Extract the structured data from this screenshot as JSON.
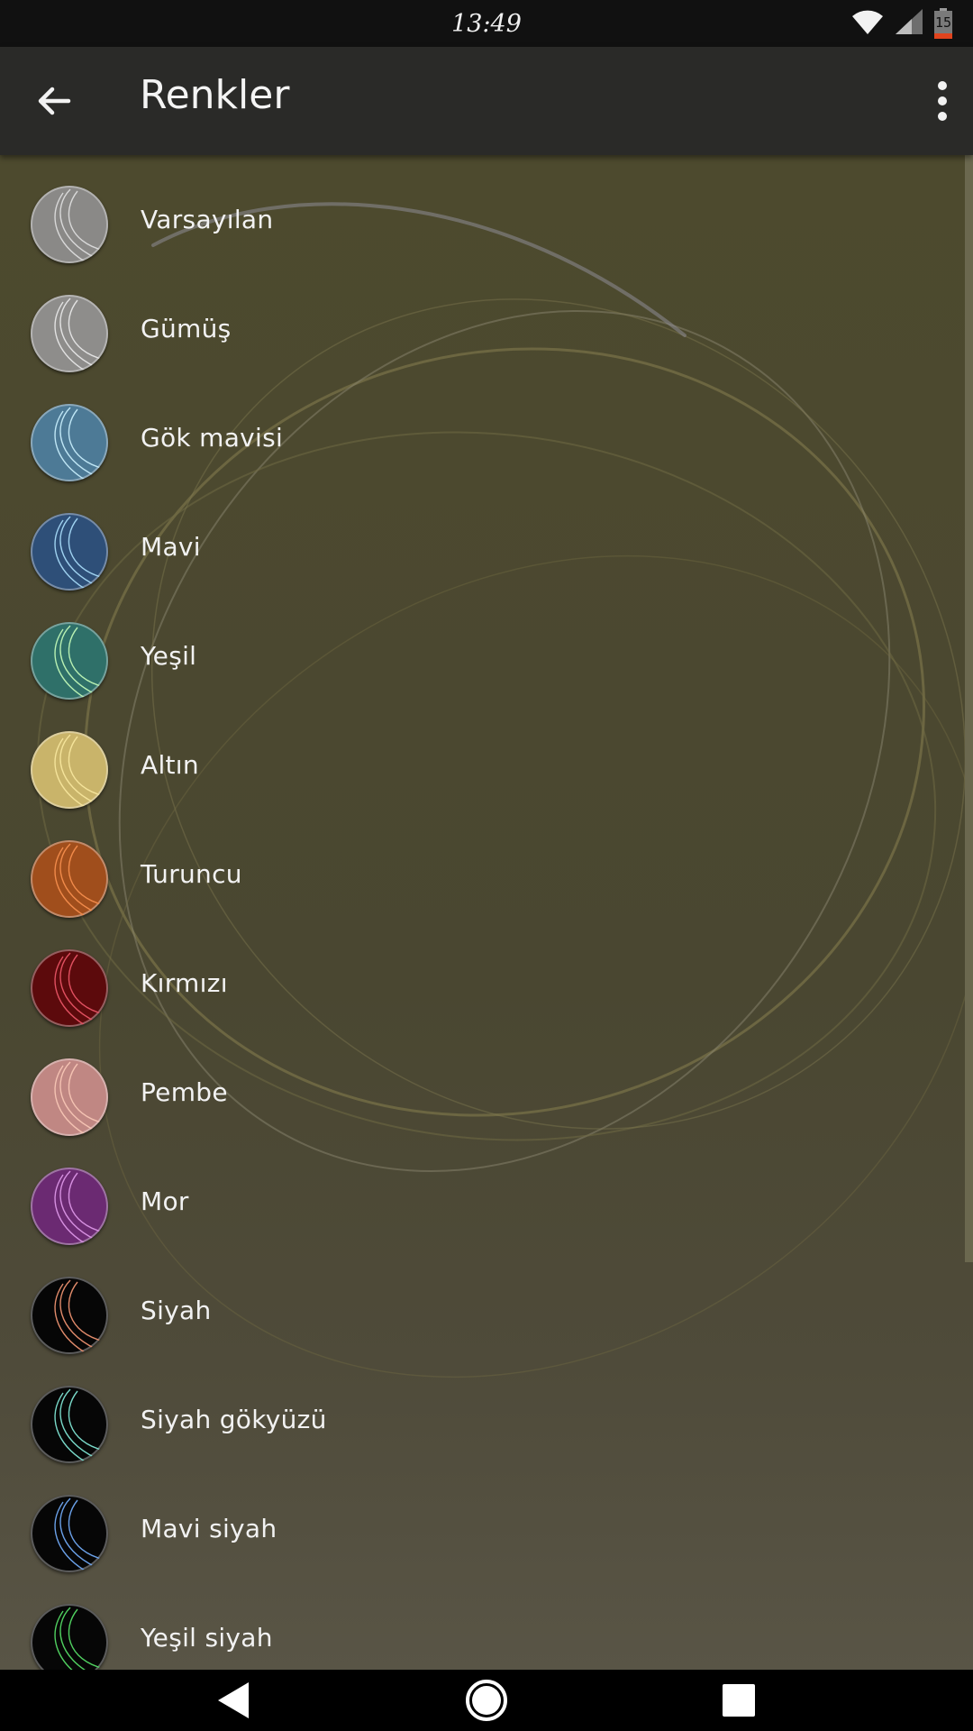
{
  "status_bar": {
    "time": "13:49",
    "battery_level": "15",
    "icons": [
      "wifi-icon",
      "cell-signal-icon",
      "battery-icon"
    ]
  },
  "app_bar": {
    "title": "Renkler",
    "back_icon": "arrow-back-icon",
    "menu_icon": "more-vertical-icon"
  },
  "colors": [
    {
      "label": "Varsayılan",
      "swatch": "#8a8987",
      "line": "#d8d8d8"
    },
    {
      "label": "Gümüş",
      "swatch": "#8e8d8b",
      "line": "#e2e2e2"
    },
    {
      "label": "Gök mavisi",
      "swatch": "#4d7a96",
      "line": "#bfe6f5"
    },
    {
      "label": "Mavi",
      "swatch": "#2e4f78",
      "line": "#9fd2f0"
    },
    {
      "label": "Yeşil",
      "swatch": "#2f7069",
      "line": "#b8f0b2"
    },
    {
      "label": "Altın",
      "swatch": "#c9b46a",
      "line": "#f4e39a"
    },
    {
      "label": "Turuncu",
      "swatch": "#a04e1c",
      "line": "#f08a4a"
    },
    {
      "label": "Kırmızı",
      "swatch": "#5c0a0c",
      "line": "#e05060"
    },
    {
      "label": "Pembe",
      "swatch": "#c08783",
      "line": "#f4c2b2"
    },
    {
      "label": "Mor",
      "swatch": "#6b2a72",
      "line": "#d690e0"
    },
    {
      "label": "Siyah",
      "swatch": "#060606",
      "line": "#e08a6a"
    },
    {
      "label": "Siyah gökyüzü",
      "swatch": "#060606",
      "line": "#78d8c8"
    },
    {
      "label": "Mavi siyah",
      "swatch": "#060606",
      "line": "#6aa0e8"
    },
    {
      "label": "Yeşil siyah",
      "swatch": "#060606",
      "line": "#50d060"
    }
  ],
  "nav_bar": {
    "back_icon": "nav-back-triangle-icon",
    "home_icon": "nav-home-circle-icon",
    "recents_icon": "nav-recents-square-icon"
  }
}
